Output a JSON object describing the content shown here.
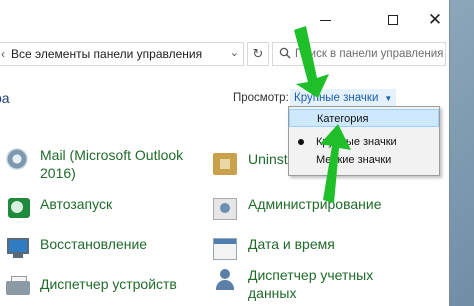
{
  "window": {
    "controls": {
      "minimize": "minimize",
      "maximize": "maximize",
      "close": "close"
    }
  },
  "address": {
    "separator": "‹",
    "path": "Все элементы панели управления",
    "dropdown_glyph": "⌄",
    "refresh_glyph": "↻"
  },
  "search": {
    "placeholder": "Поиск в панели управления",
    "icon": "search-icon"
  },
  "left": {
    "title_fragment": "ра"
  },
  "view": {
    "label": "Просмотр:",
    "selected": "Крупные значки"
  },
  "view_menu": {
    "items": [
      {
        "label": "Категория",
        "highlighted": true,
        "selected": false
      },
      {
        "label": "Крупные значки",
        "highlighted": false,
        "selected": true
      },
      {
        "label": "Мелкие значки",
        "highlighted": false,
        "selected": false
      }
    ]
  },
  "items": [
    {
      "label_line1": "Mail (Microsoft Outlook",
      "label_line2": "2016)",
      "icon": "mail-settings-icon"
    },
    {
      "label_line1": "Автозапуск",
      "icon": "autoplay-icon"
    },
    {
      "label_line1": "Восстановление",
      "icon": "recovery-icon"
    },
    {
      "label_line1": "Диспетчер устройств",
      "icon": "device-manager-icon"
    },
    {
      "label_line1": "Uninsta",
      "icon": "uninstall-icon"
    },
    {
      "label_line1": "Администрирование",
      "icon": "administration-icon"
    },
    {
      "label_line1": "Дата и время",
      "icon": "date-time-icon"
    },
    {
      "label_line1": "Диспетчер учетных",
      "label_line2": "данных",
      "icon": "credential-manager-icon"
    }
  ],
  "colors": {
    "link_green": "#1f6b2a",
    "accent_blue": "#1a5fb4",
    "menu_highlight": "#cde8ff",
    "arrow_green": "#1fbf2a"
  }
}
